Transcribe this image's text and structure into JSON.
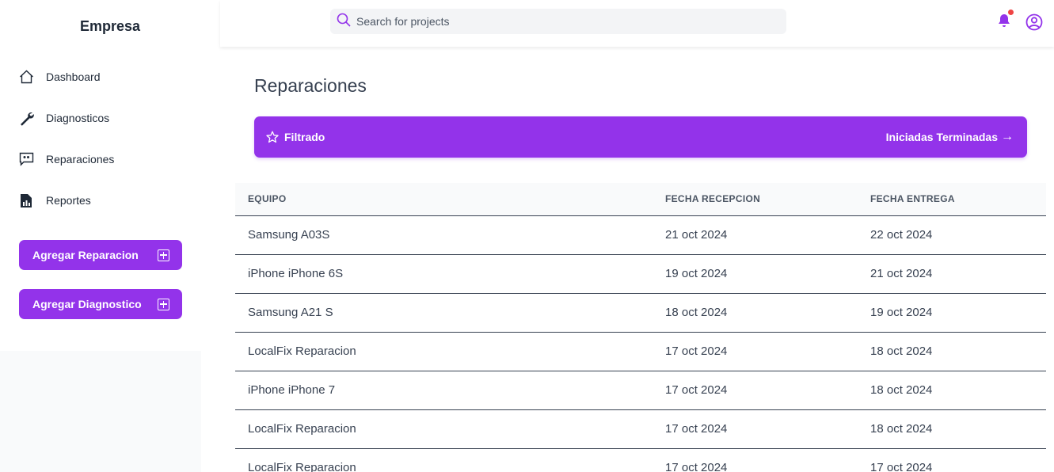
{
  "brand": "Empresa",
  "nav": [
    {
      "label": "Dashboard",
      "icon": "home-icon"
    },
    {
      "label": "Diagnosticos",
      "icon": "wrench-icon"
    },
    {
      "label": "Reparaciones",
      "icon": "chat-quote-icon"
    },
    {
      "label": "Reportes",
      "icon": "report-file-icon"
    }
  ],
  "actions": {
    "add_repair": "Agregar Reparacion",
    "add_diagnostic": "Agregar Diagnostico"
  },
  "search": {
    "placeholder": "Search for projects"
  },
  "page": {
    "title": "Reparaciones"
  },
  "filter": {
    "label": "Filtrado",
    "right": "Iniciadas Terminadas"
  },
  "table": {
    "headers": [
      "EQUIPO",
      "FECHA RECEPCION",
      "FECHA ENTREGA"
    ],
    "rows": [
      [
        "Samsung A03S",
        "21 oct 2024",
        "22 oct 2024"
      ],
      [
        "iPhone iPhone 6S",
        "19 oct 2024",
        "21 oct 2024"
      ],
      [
        "Samsung A21 S",
        "18 oct 2024",
        "19 oct 2024"
      ],
      [
        "LocalFix Reparacion",
        "17 oct 2024",
        "18 oct 2024"
      ],
      [
        "iPhone iPhone 7",
        "17 oct 2024",
        "18 oct 2024"
      ],
      [
        "LocalFix Reparacion",
        "17 oct 2024",
        "18 oct 2024"
      ],
      [
        "LocalFix Reparacion",
        "17 oct 2024",
        "17 oct 2024"
      ]
    ]
  },
  "colors": {
    "accent": "#9333ea",
    "notification": "#ef4444"
  }
}
